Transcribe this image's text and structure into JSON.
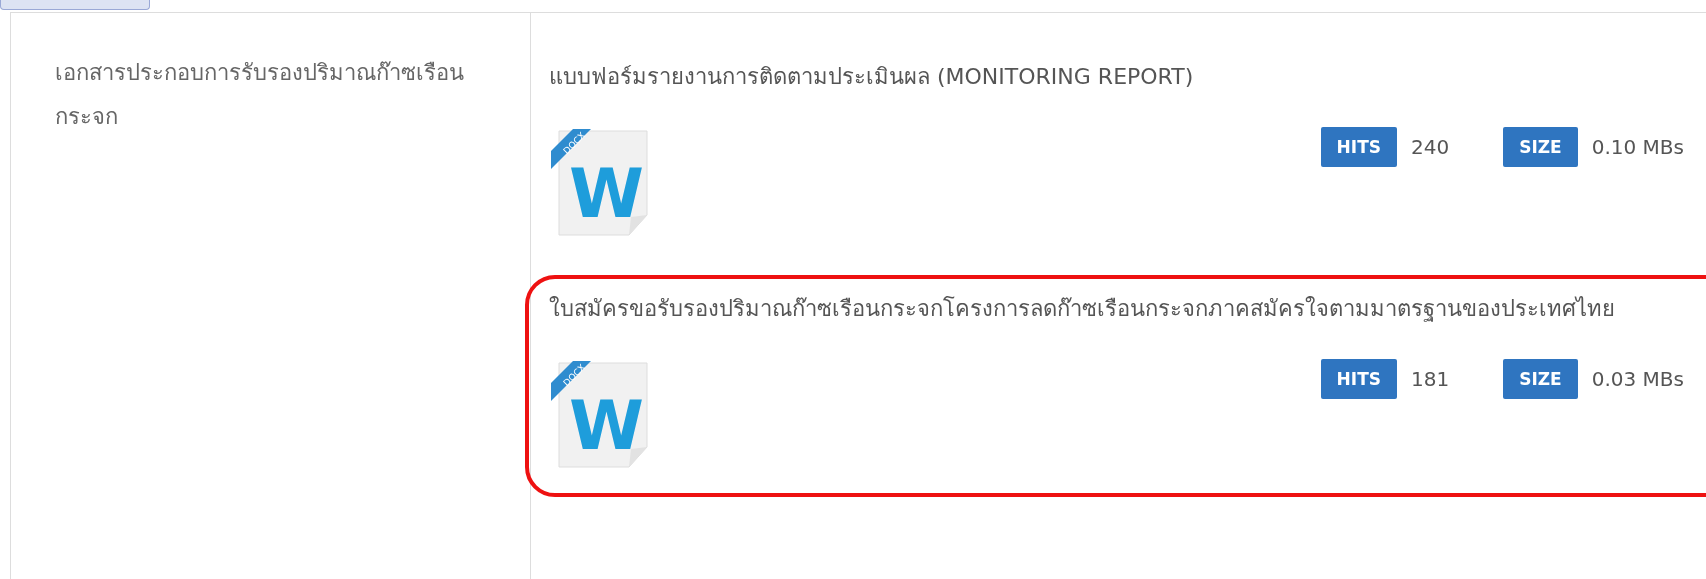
{
  "category": {
    "label": "เอกสารประกอบการรับรองปริมาณก๊าซเรือนกระจก"
  },
  "documents": [
    {
      "title": "แบบฟอร์มรายงานการติดตามประเมินผล (MONITORING REPORT)",
      "file_type": "DOCX",
      "file_letter": "W",
      "hits_label": "HITS",
      "hits": "240",
      "size_label": "SIZE",
      "size": "0.10 MBs",
      "highlighted": false
    },
    {
      "title": "ใบสมัครขอรับรองปริมาณก๊าซเรือนกระจกโครงการลดก๊าซเรือนกระจกภาคสมัครใจตามมาตรฐานของประเทศไทย",
      "file_type": "DOCX",
      "file_letter": "W",
      "hits_label": "HITS",
      "hits": "181",
      "size_label": "SIZE",
      "size": "0.03 MBs",
      "highlighted": true
    }
  ]
}
